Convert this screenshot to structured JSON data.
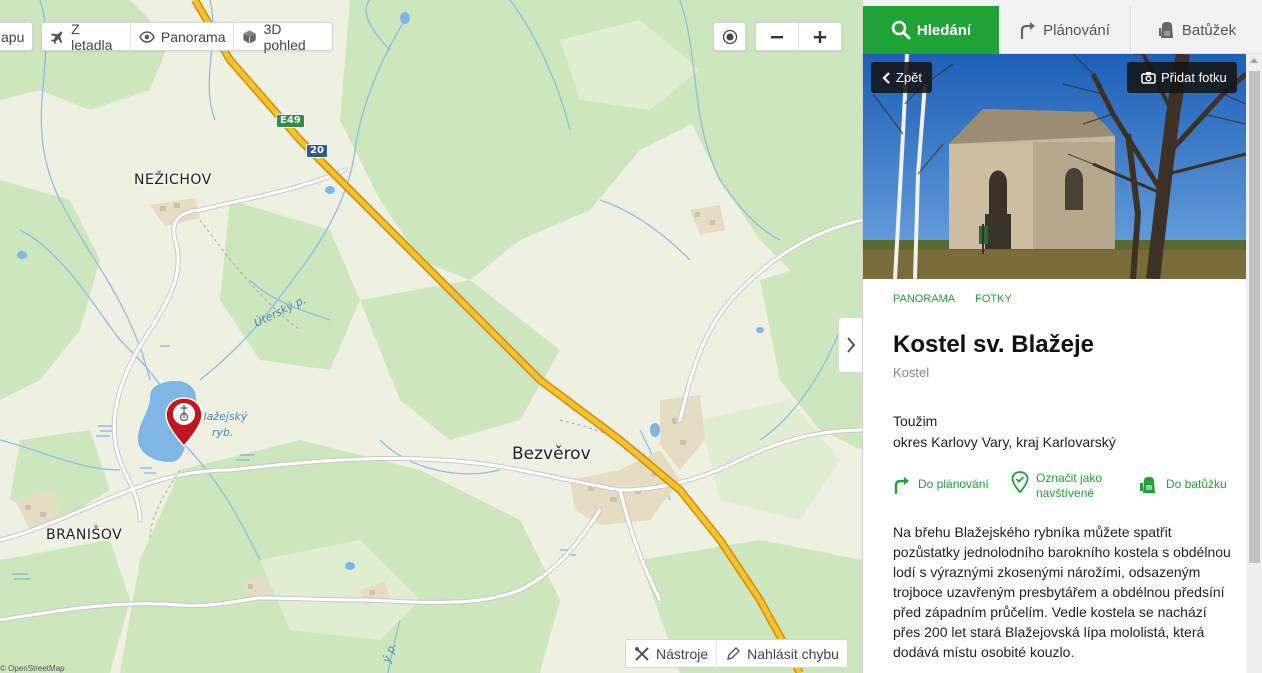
{
  "map": {
    "toolbar": {
      "map_tab_label": "apu",
      "aerial_label": "Z letadla",
      "panorama_label": "Panorama",
      "view3d_label": "3D pohled"
    },
    "places": {
      "nezichov": "NEŽICHOV",
      "bezverov": "Bezvěrov",
      "branisov": "BRANIŠOV"
    },
    "water": {
      "pond_line1": "Blažejský",
      "pond_line2": "ryb.",
      "creek": "Úterský p.",
      "creek2": "ý p."
    },
    "shields": {
      "e49": "E49",
      "r20": "20"
    },
    "bottom_tools": {
      "tools_label": "Nástroje",
      "report_label": "Nahlásit chybu"
    },
    "credit": "© OpenStreetMap"
  },
  "panel": {
    "tabs": [
      {
        "label": "Hledání"
      },
      {
        "label": "Plánování"
      },
      {
        "label": "Batůžek"
      }
    ],
    "back_label": "Zpět",
    "add_photo_label": "Přidat fotku",
    "sub_links": [
      "PANORAMA",
      "FOTKY"
    ],
    "title": "Kostel sv. Blažeje",
    "subtitle": "Kostel",
    "address_line1": "Toužim",
    "address_line2": "okres Karlovy Vary, kraj Karlovarský",
    "actions": {
      "plan": "Do plánování",
      "visited_line1": "Označit jako",
      "visited_line2": "navštívené",
      "backpack": "Do batůžku"
    },
    "description": "Na břehu Blažejského rybníka můžete spatřit pozůstatky jednolodního barokního kostela s obdélnou lodí s výraznými zkosenými nárožími, odsazeným trojboce uzavřeným presbytářem a obdélnou předsíní před západním průčelím. Vedle kostela se nachází přes 200 let stará Blažejovská lípa mololistá, která dodává místu osobité kouzlo."
  },
  "colors": {
    "accent_green": "#1fa336",
    "highway": "#f2b31c",
    "water": "#7fb6e3",
    "forest": "#c9e3b8",
    "marker_red": "#c0161d"
  }
}
